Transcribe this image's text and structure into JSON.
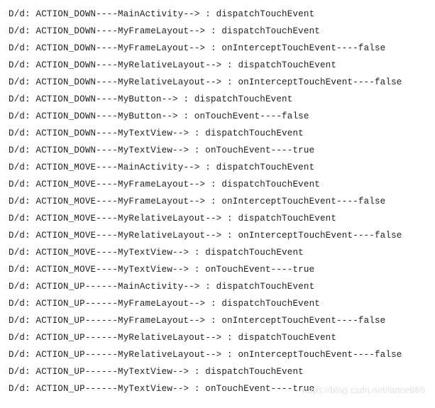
{
  "log": {
    "lines": [
      "D/d: ACTION_DOWN----MainActivity--> : dispatchTouchEvent",
      "D/d: ACTION_DOWN----MyFrameLayout--> : dispatchTouchEvent",
      "D/d: ACTION_DOWN----MyFrameLayout--> : onInterceptTouchEvent----false",
      "D/d: ACTION_DOWN----MyRelativeLayout--> : dispatchTouchEvent",
      "D/d: ACTION_DOWN----MyRelativeLayout--> : onInterceptTouchEvent----false",
      "D/d: ACTION_DOWN----MyButton--> : dispatchTouchEvent",
      "D/d: ACTION_DOWN----MyButton--> : onTouchEvent----false",
      "D/d: ACTION_DOWN----MyTextView--> : dispatchTouchEvent",
      "D/d: ACTION_DOWN----MyTextView--> : onTouchEvent----true",
      "D/d: ACTION_MOVE----MainActivity--> : dispatchTouchEvent",
      "D/d: ACTION_MOVE----MyFrameLayout--> : dispatchTouchEvent",
      "D/d: ACTION_MOVE----MyFrameLayout--> : onInterceptTouchEvent----false",
      "D/d: ACTION_MOVE----MyRelativeLayout--> : dispatchTouchEvent",
      "D/d: ACTION_MOVE----MyRelativeLayout--> : onInterceptTouchEvent----false",
      "D/d: ACTION_MOVE----MyTextView--> : dispatchTouchEvent",
      "D/d: ACTION_MOVE----MyTextView--> : onTouchEvent----true",
      "D/d: ACTION_UP------MainActivity--> : dispatchTouchEvent",
      "D/d: ACTION_UP------MyFrameLayout--> : dispatchTouchEvent",
      "D/d: ACTION_UP------MyFrameLayout--> : onInterceptTouchEvent----false",
      "D/d: ACTION_UP------MyRelativeLayout--> : dispatchTouchEvent",
      "D/d: ACTION_UP------MyRelativeLayout--> : onInterceptTouchEvent----false",
      "D/d: ACTION_UP------MyTextView--> : dispatchTouchEvent",
      "D/d: ACTION_UP------MyTextView--> : onTouchEvent----true"
    ]
  },
  "watermark": "https://blog.csdn.net/lance666"
}
